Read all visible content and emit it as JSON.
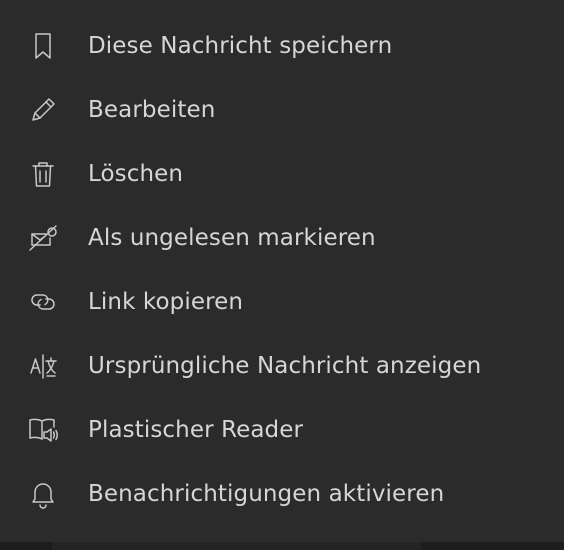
{
  "menu": {
    "items": [
      {
        "label": "Diese Nachricht speichern",
        "icon": "bookmark-icon"
      },
      {
        "label": "Bearbeiten",
        "icon": "pencil-icon"
      },
      {
        "label": "Löschen",
        "icon": "trash-icon"
      },
      {
        "label": "Als ungelesen markieren",
        "icon": "unread-icon"
      },
      {
        "label": "Link kopieren",
        "icon": "link-icon"
      },
      {
        "label": "Ursprüngliche Nachricht anzeigen",
        "icon": "translate-icon"
      },
      {
        "label": "Plastischer Reader",
        "icon": "immersive-reader-icon"
      },
      {
        "label": "Benachrichtigungen aktivieren",
        "icon": "bell-icon"
      }
    ]
  },
  "colors": {
    "background": "#2b2b2b",
    "text": "#d6d6d6",
    "icon": "#c8c8c8"
  }
}
